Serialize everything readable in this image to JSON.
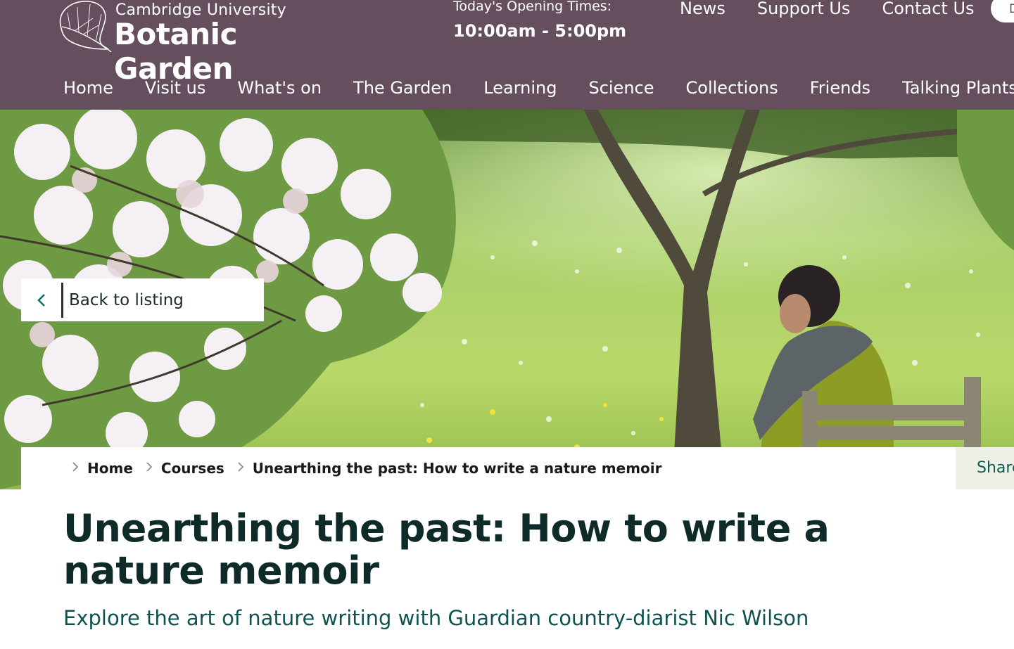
{
  "brand": {
    "line1": "Cambridge University",
    "line2": "Botanic Garden"
  },
  "opening": {
    "label": "Today's Opening Times:",
    "hours": "10:00am - 5:00pm"
  },
  "utility_nav": [
    "News",
    "Support Us",
    "Contact Us"
  ],
  "utility_pill_label": "D",
  "main_nav": [
    "Home",
    "Visit us",
    "What's on",
    "The Garden",
    "Learning",
    "Science",
    "Collections",
    "Friends",
    "Talking Plants"
  ],
  "back": {
    "label": "Back to listing",
    "icon": "chevron-left-icon"
  },
  "breadcrumb": [
    "Home",
    "Courses",
    "Unearthing the past: How to write a nature memoir"
  ],
  "share_label": "Share",
  "title": "Unearthing the past: How to write a nature memoir",
  "subtitle": "Explore the art of nature writing with Guardian country-diarist Nic Wilson",
  "colors": {
    "header": "#654f5e",
    "title": "#0e2b29",
    "accent": "#0d7066",
    "share_bg": "#eef2e6"
  }
}
